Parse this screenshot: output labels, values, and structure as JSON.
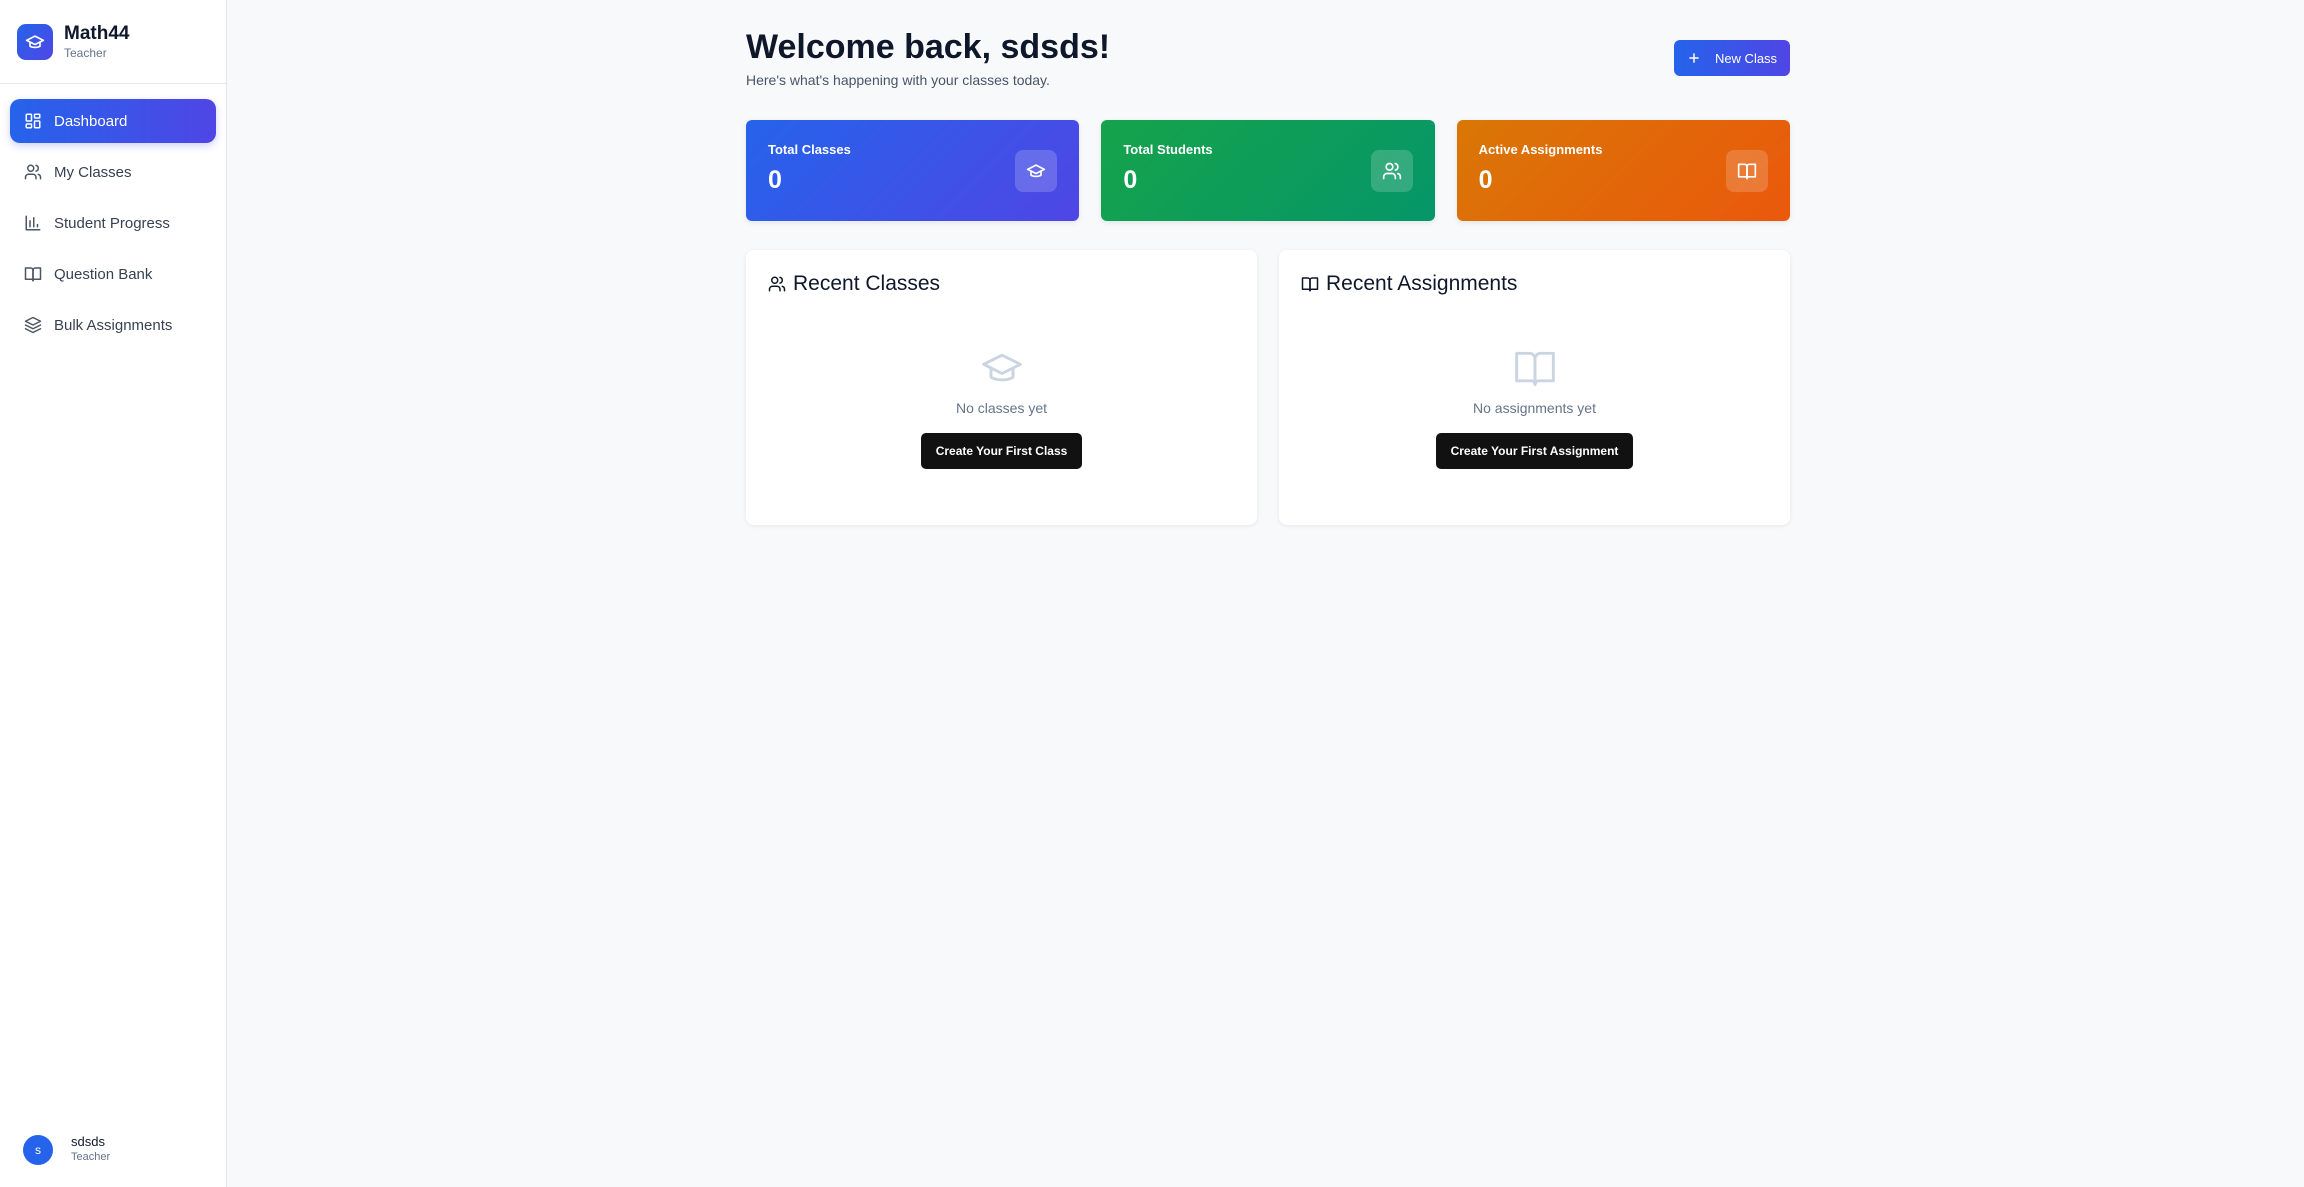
{
  "brand": {
    "name": "Math44",
    "role": "Teacher",
    "icon": "graduation-cap-icon"
  },
  "sidebar": {
    "items": [
      {
        "label": "Dashboard",
        "icon": "dashboard-icon",
        "active": true
      },
      {
        "label": "My Classes",
        "icon": "users-icon"
      },
      {
        "label": "Student Progress",
        "icon": "bar-chart-icon"
      },
      {
        "label": "Question Bank",
        "icon": "book-icon"
      },
      {
        "label": "Bulk Assignments",
        "icon": "layers-icon"
      }
    ]
  },
  "user": {
    "initial": "s",
    "name": "sdsds",
    "role": "Teacher"
  },
  "header": {
    "title": "Welcome back, sdsds!",
    "subtitle": "Here's what's happening with your classes today.",
    "new_class_label": "New Class"
  },
  "stats": [
    {
      "label": "Total Classes",
      "value": "0",
      "icon": "graduation-cap-icon",
      "color": "#2563eb"
    },
    {
      "label": "Total Students",
      "value": "0",
      "icon": "users-icon",
      "color": "#16a34a"
    },
    {
      "label": "Active Assignments",
      "value": "0",
      "icon": "book-icon",
      "color": "#ea580c"
    }
  ],
  "recent_classes": {
    "title": "Recent Classes",
    "empty_text": "No classes yet",
    "button_label": "Create Your First Class"
  },
  "recent_assignments": {
    "title": "Recent Assignments",
    "empty_text": "No assignments yet",
    "button_label": "Create Your First Assignment"
  }
}
